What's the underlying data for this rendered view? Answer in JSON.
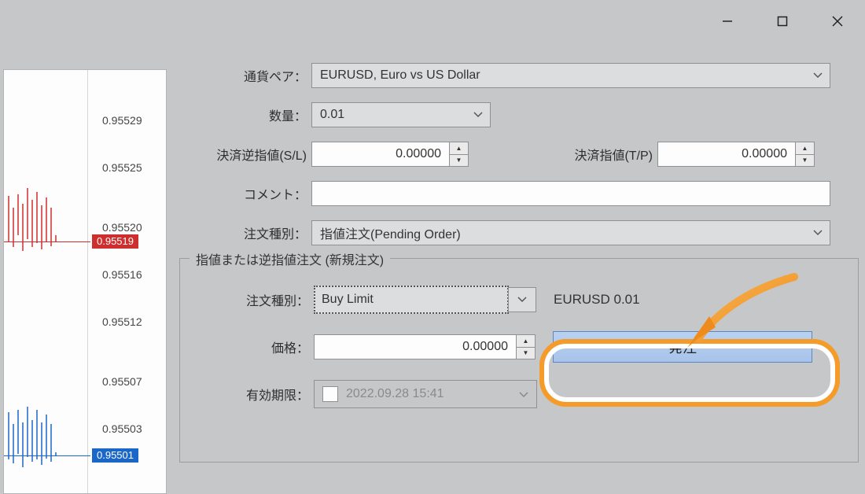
{
  "window": {
    "minimize": "—",
    "maximize": "▢",
    "close": "✕"
  },
  "chart": {
    "yticks": [
      "0.95529",
      "0.95525",
      "0.95520",
      "0.95516",
      "0.95512",
      "0.95507",
      "0.95503"
    ],
    "ask_price": "0.95519",
    "bid_price": "0.95501"
  },
  "form": {
    "symbol_label": "通貨ペア：",
    "symbol_value": "EURUSD, Euro vs US Dollar",
    "volume_label": "数量：",
    "volume_value": "0.01",
    "sl_label": "決済逆指値(S/L)",
    "sl_value": "0.00000",
    "tp_label": "決済指値(T/P)",
    "tp_value": "0.00000",
    "comment_label": "コメント：",
    "comment_value": "",
    "ordertype_label": "注文種別：",
    "ordertype_value": "指値注文(Pending Order)"
  },
  "pending": {
    "group_title": "指値または逆指値注文 (新規注文)",
    "type_label": "注文種別：",
    "type_value": "Buy Limit",
    "summary": "EURUSD 0.01",
    "price_label": "価格：",
    "price_value": "0.00000",
    "submit_label": "発注",
    "expiry_label": "有効期限：",
    "expiry_value": "2022.09.28 15:41"
  }
}
